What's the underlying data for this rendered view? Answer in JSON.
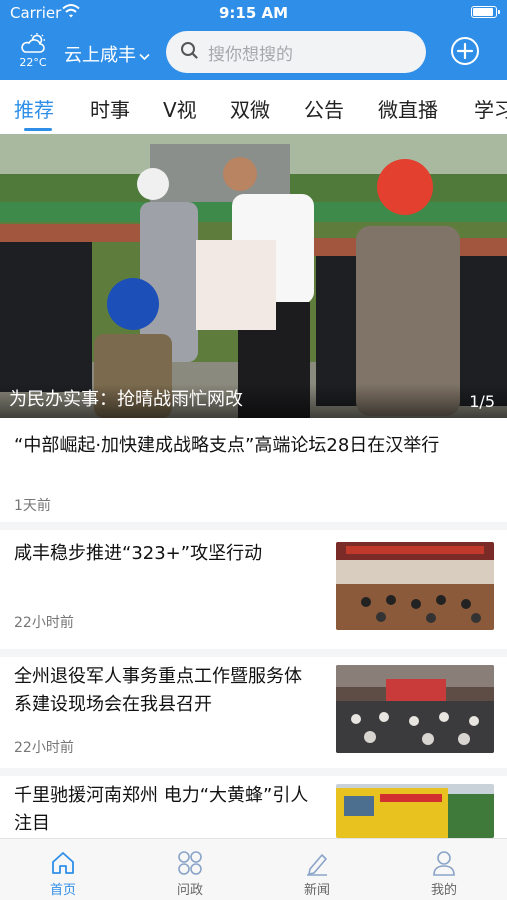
{
  "status_bar": {
    "carrier": "Carrier",
    "time": "9:15 AM"
  },
  "header": {
    "temperature": "22°C",
    "location": "云上咸丰",
    "search_placeholder": "搜你想搜的",
    "accent_color": "#2f8fe8"
  },
  "tabs": [
    "推荐",
    "时事",
    "V视",
    "双微",
    "公告",
    "微直播",
    "学习"
  ],
  "active_tab": "推荐",
  "banner": {
    "caption": "为民办实事：抢晴战雨忙网改",
    "pager": "1/5"
  },
  "news": [
    {
      "title": "“中部崛起·加快建成战略支点”高端论坛28日在汉举行",
      "time": "1天前"
    },
    {
      "title": "咸丰稳步推进“323+”攻坚行动",
      "time": "22小时前"
    },
    {
      "title": "全州退役军人事务重点工作暨服务体系建设现场会在我县召开",
      "time": "22小时前"
    },
    {
      "title": "千里驰援河南郑州 电力“大黄蜂”引人注目",
      "time": ""
    }
  ],
  "bottom_nav": [
    {
      "label": "首页",
      "icon": "home-icon"
    },
    {
      "label": "问政",
      "icon": "grid-icon"
    },
    {
      "label": "新闻",
      "icon": "pen-icon"
    },
    {
      "label": "我的",
      "icon": "user-icon"
    }
  ]
}
